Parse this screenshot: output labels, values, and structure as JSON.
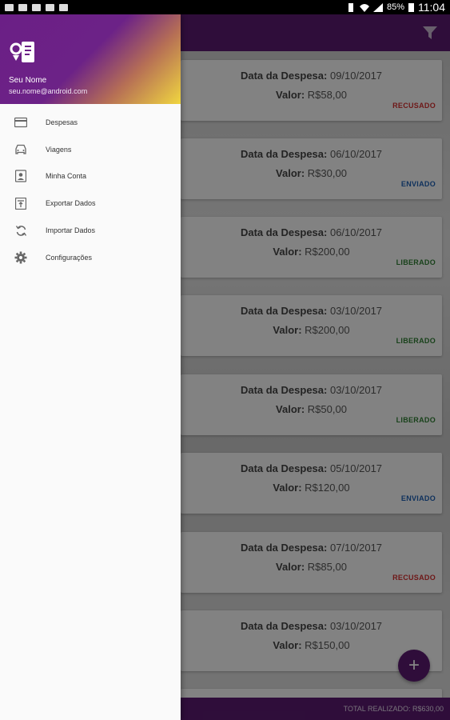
{
  "status_bar": {
    "battery": "85%",
    "time": "11:04"
  },
  "drawer": {
    "user_name": "Seu Nome",
    "user_email": "seu.nome@android.com",
    "items": [
      {
        "label": "Despesas",
        "icon": "card-icon"
      },
      {
        "label": "Viagens",
        "icon": "car-icon"
      },
      {
        "label": "Minha Conta",
        "icon": "account-icon"
      },
      {
        "label": "Exportar Dados",
        "icon": "export-icon"
      },
      {
        "label": "Importar Dados",
        "icon": "sync-icon"
      },
      {
        "label": "Configurações",
        "icon": "gear-icon"
      }
    ]
  },
  "expenses": [
    {
      "date_label": "Data da Despesa:",
      "date": "09/10/2017",
      "value_label": "Valor:",
      "value": "R$58,00",
      "status": "RECUSADO"
    },
    {
      "date_label": "Data da Despesa:",
      "date": "06/10/2017",
      "value_label": "Valor:",
      "value": "R$30,00",
      "status": "ENVIADO"
    },
    {
      "date_label": "Data da Despesa:",
      "date": "06/10/2017",
      "value_label": "Valor:",
      "value": "R$200,00",
      "status": "LIBERADO"
    },
    {
      "date_label": "Data da Despesa:",
      "date": "03/10/2017",
      "value_label": "Valor:",
      "value": "R$200,00",
      "status": "LIBERADO"
    },
    {
      "date_label": "Data da Despesa:",
      "date": "03/10/2017",
      "value_label": "Valor:",
      "value": "R$50,00",
      "status": "LIBERADO"
    },
    {
      "date_label": "Data da Despesa:",
      "date": "05/10/2017",
      "value_label": "Valor:",
      "value": "R$120,00",
      "status": "ENVIADO"
    },
    {
      "date_label": "Data da Despesa:",
      "date": "07/10/2017",
      "value_label": "Valor:",
      "value": "R$85,00",
      "status": "RECUSADO"
    },
    {
      "date_label": "Data da Despesa:",
      "date": "03/10/2017",
      "value_label": "Valor:",
      "value": "R$150,00",
      "status": ""
    }
  ],
  "status_colors": {
    "RECUSADO": "#d32f2f",
    "ENVIADO": "#1e5fb3",
    "LIBERADO": "#2e7d32"
  },
  "footer": {
    "total": "TOTAL REALIZADO: R$630,00"
  },
  "fab": {
    "label": "+"
  },
  "colors": {
    "primary": "#5a1a70",
    "accent_yellow": "#f0d640"
  }
}
